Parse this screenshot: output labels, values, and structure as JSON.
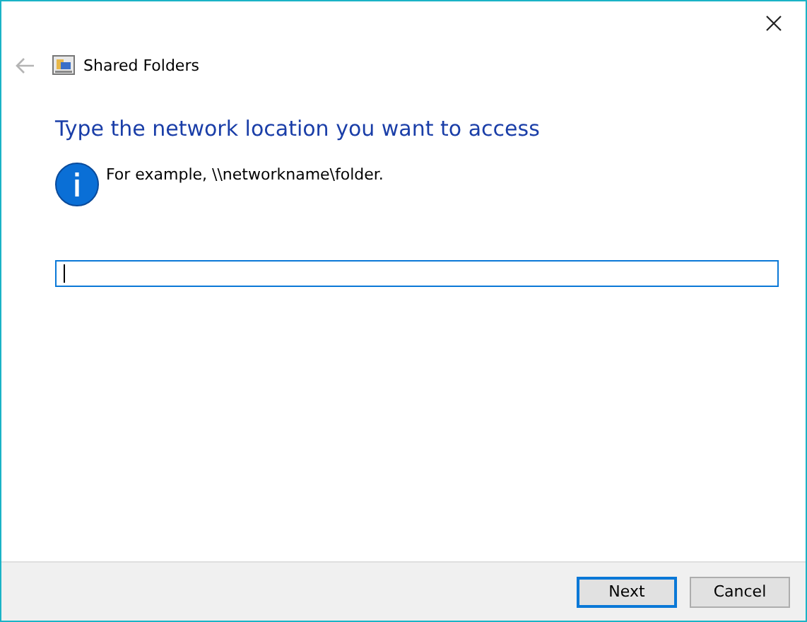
{
  "window": {
    "title": "Shared Folders",
    "back_disabled": true
  },
  "heading": "Type the network location you want to access",
  "info": "For example, \\\\networkname\\folder.",
  "location_field": {
    "focused": true
  },
  "buttons": [
    {
      "label": "Next",
      "default": true
    },
    {
      "label": "Cancel",
      "default": false
    }
  ]
}
